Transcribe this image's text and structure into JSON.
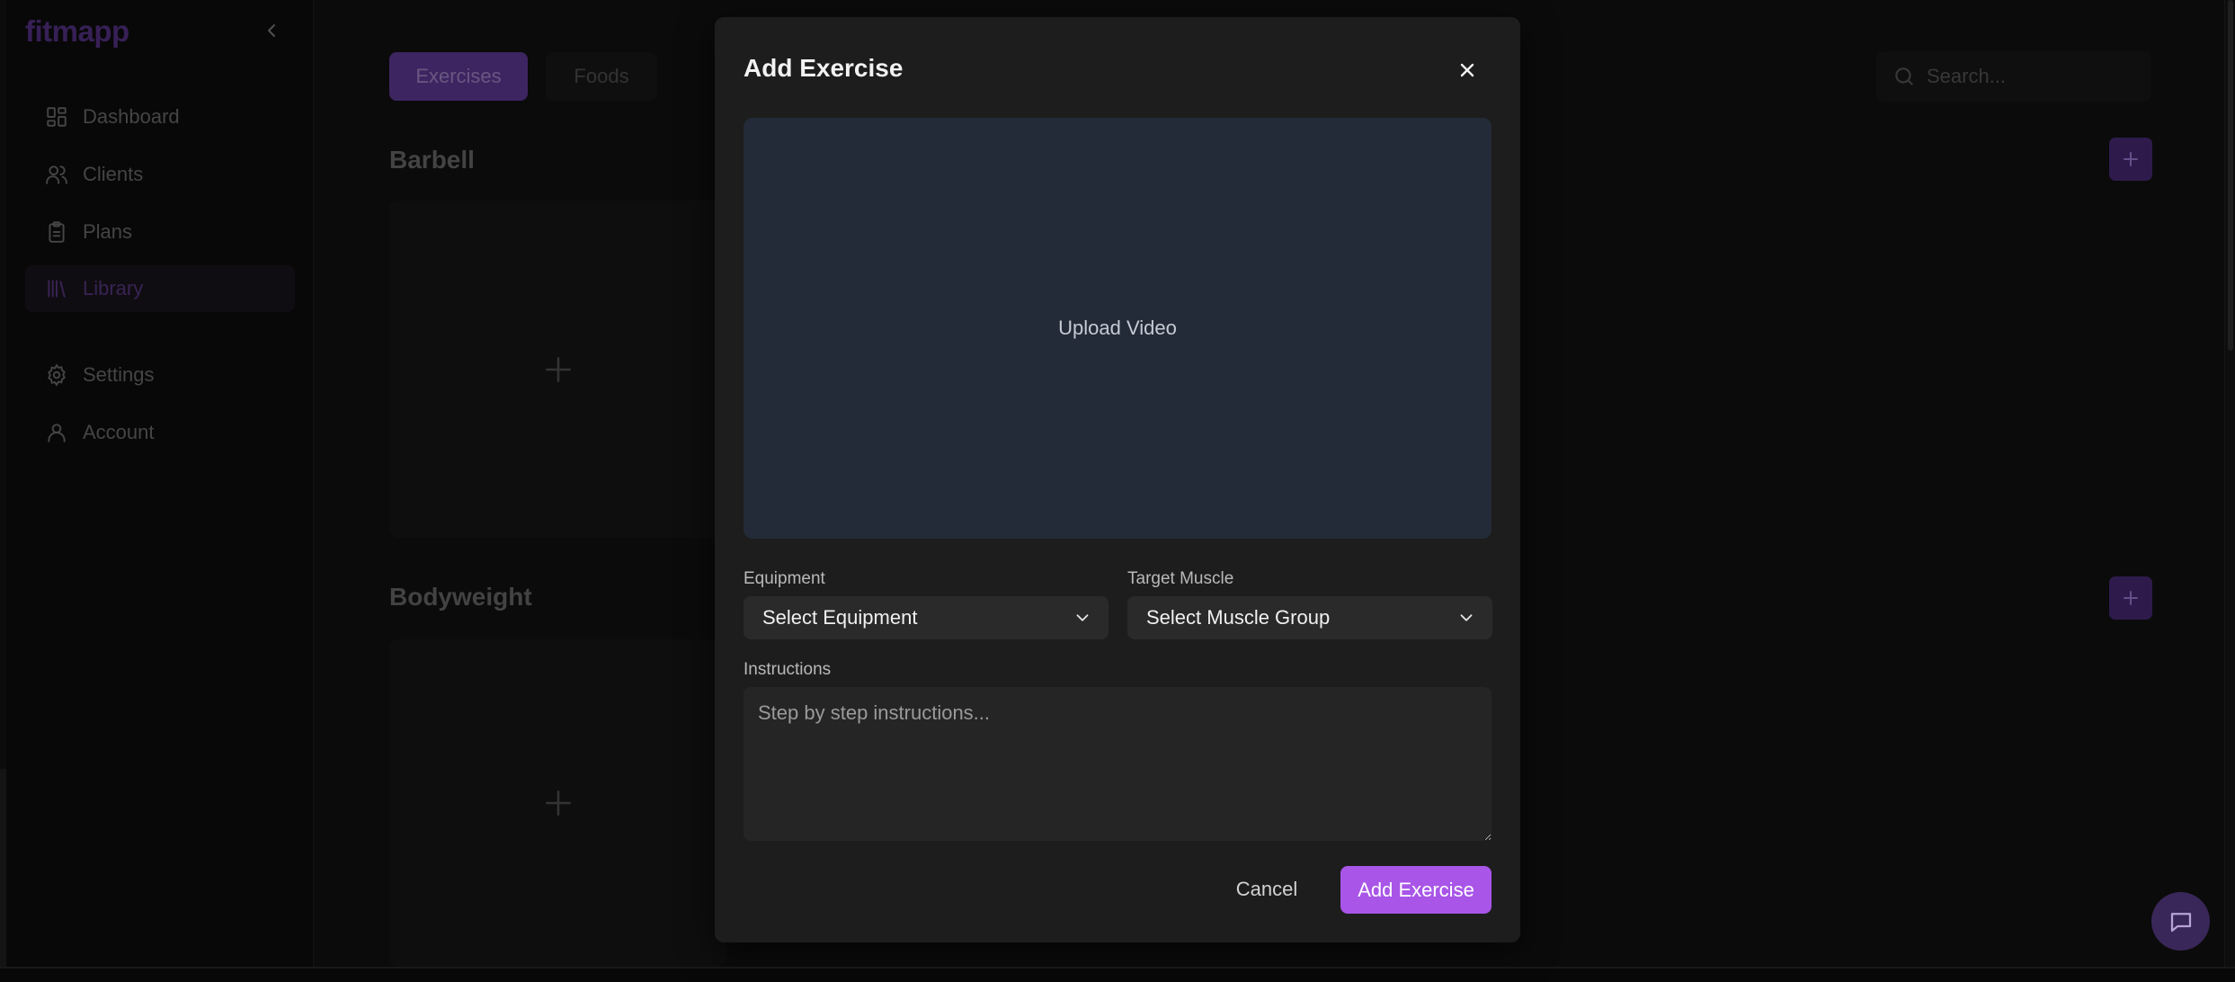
{
  "app": {
    "logo": "fitmapp"
  },
  "sidebar": {
    "items": [
      {
        "label": "Dashboard",
        "icon": "grid-icon"
      },
      {
        "label": "Clients",
        "icon": "users-icon"
      },
      {
        "label": "Plans",
        "icon": "clipboard-icon"
      },
      {
        "label": "Library",
        "icon": "library-icon",
        "active": true
      },
      {
        "label": "Settings",
        "icon": "gear-icon"
      },
      {
        "label": "Account",
        "icon": "user-icon"
      }
    ]
  },
  "main": {
    "tabs": [
      {
        "label": "Exercises",
        "active": true
      },
      {
        "label": "Foods",
        "active": false
      }
    ],
    "search": {
      "placeholder": "Search..."
    },
    "sections": [
      {
        "title": "Barbell"
      },
      {
        "title": "Bodyweight"
      }
    ]
  },
  "modal": {
    "title": "Add Exercise",
    "upload_label": "Upload Video",
    "equipment": {
      "label": "Equipment",
      "value": "Select Equipment"
    },
    "target_muscle": {
      "label": "Target Muscle",
      "value": "Select Muscle Group"
    },
    "instructions": {
      "label": "Instructions",
      "placeholder": "Step by step instructions..."
    },
    "cancel_label": "Cancel",
    "submit_label": "Add Exercise"
  },
  "colors": {
    "accent": "#a855e8",
    "modal_bg": "#1d1d1d",
    "upload_bg": "#242b38",
    "page_bg": "#0f0f0f"
  }
}
